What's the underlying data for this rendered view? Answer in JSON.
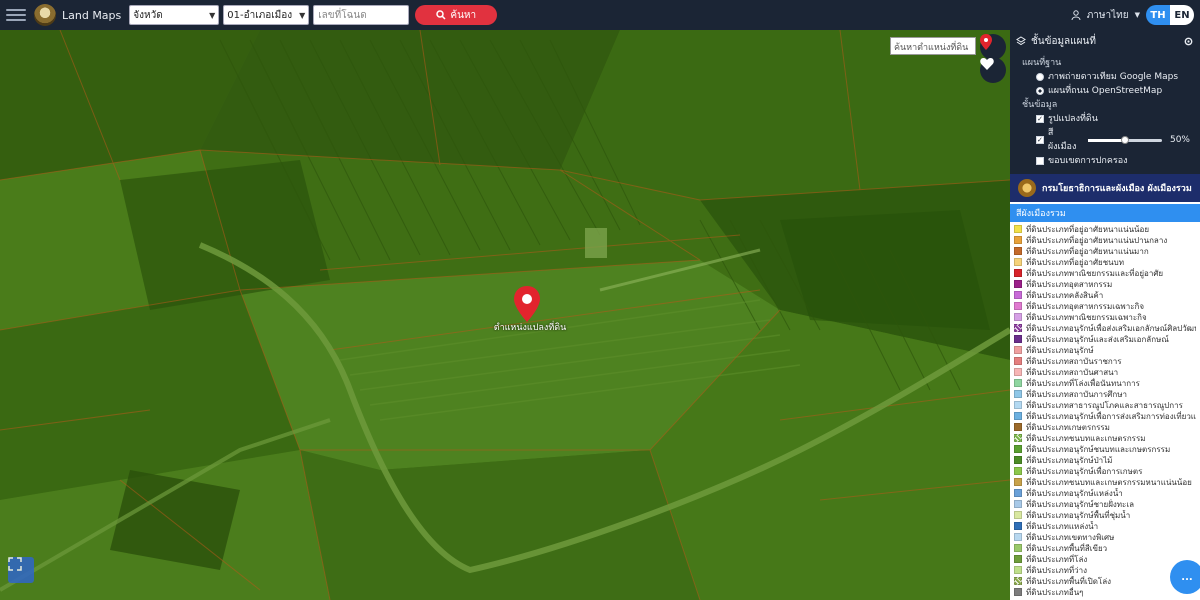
{
  "header": {
    "brand": "Land Maps",
    "province_select": "จังหวัด",
    "district_select": "01-อำเภอเมือง",
    "parcel_input_placeholder": "เลขที่โฉนด",
    "search_label": "ค้นหา",
    "user_label": "ภาษาไทย",
    "lang_on": "TH",
    "lang_off": "EN"
  },
  "map": {
    "search_value": "ค้นหาตำแหน่งที่ดิน",
    "pin_label": "ตำแหน่งแปลงที่ดิน"
  },
  "panel": {
    "title": "ชั้นข้อมูลแผนที่",
    "basemap_heading": "แผนที่ฐาน",
    "basemap_options": [
      {
        "label": "ภาพถ่ายดาวเทียม Google Maps",
        "selected": false
      },
      {
        "label": "แผนที่ถนน OpenStreetMap",
        "selected": true
      }
    ],
    "overlay_heading": "ชั้นข้อมูล",
    "overlays": [
      {
        "label": "รูปแปลงที่ดิน",
        "checked": true
      },
      {
        "label": "สีผังเมือง",
        "checked": true,
        "opacity_percent": 50,
        "opacity_text": "50%"
      },
      {
        "label": "ขอบเขตการปกครอง",
        "checked": false
      }
    ],
    "department": "กรมโยธาธิการและผังเมือง ผังเมืองรวม",
    "legend_title": "สีผังเมืองรวม",
    "legend": [
      {
        "color": "#f2e14a",
        "label": "ที่ดินประเภทที่อยู่อาศัยหนาแน่นน้อย"
      },
      {
        "color": "#e8a23a",
        "label": "ที่ดินประเภทที่อยู่อาศัยหนาแน่นปานกลาง"
      },
      {
        "color": "#c46a2a",
        "label": "ที่ดินประเภทที่อยู่อาศัยหนาแน่นมาก"
      },
      {
        "color": "#f6d37a",
        "label": "ที่ดินประเภทที่อยู่อาศัยชนบท"
      },
      {
        "color": "#d8232a",
        "label": "ที่ดินประเภทพาณิชยกรรมและที่อยู่อาศัย"
      },
      {
        "color": "#9c1f8a",
        "label": "ที่ดินประเภทอุตสาหกรรม"
      },
      {
        "color": "#c86ad8",
        "label": "ที่ดินประเภทคลังสินค้า"
      },
      {
        "color": "#e07ad0",
        "label": "ที่ดินประเภทอุตสาหกรรมเฉพาะกิจ"
      },
      {
        "color": "#d6a0e6",
        "label": "ที่ดินประเภทพาณิชยกรรมเฉพาะกิจ"
      },
      {
        "color": "#8b3c9e",
        "label": "ที่ดินประเภทอนุรักษ์เพื่อส่งเสริมเอกลักษณ์ศิลปวัฒนธรรมไทย",
        "hatch": true
      },
      {
        "color": "#6b2e8c",
        "label": "ที่ดินประเภทอนุรักษ์และส่งเสริมเอกลักษณ์"
      },
      {
        "color": "#f0a0a0",
        "label": "ที่ดินประเภทอนุรักษ์"
      },
      {
        "color": "#e57f7f",
        "label": "ที่ดินประเภทสถาบันราชการ"
      },
      {
        "color": "#f7b5b5",
        "label": "ที่ดินประเภทสถาบันศาสนา"
      },
      {
        "color": "#8fd6a0",
        "label": "ที่ดินประเภทที่โล่งเพื่อนันทนาการ"
      },
      {
        "color": "#8fc7e8",
        "label": "ที่ดินประเภทสถาบันการศึกษา"
      },
      {
        "color": "#b3d9f2",
        "label": "ที่ดินประเภทสาธารณูปโภคและสาธารณูปการ"
      },
      {
        "color": "#6cb0e0",
        "label": "ที่ดินประเภทอนุรักษ์เพื่อการส่งเสริมการท่องเที่ยวและสิ่งแวดล้อม"
      },
      {
        "color": "#9c6a2a",
        "label": "ที่ดินประเภทเกษตรกรรม"
      },
      {
        "color": "#7ab648",
        "label": "ที่ดินประเภทชนบทและเกษตรกรรม",
        "hatch": true
      },
      {
        "color": "#5aa030",
        "label": "ที่ดินประเภทอนุรักษ์ชนบทและเกษตรกรรม"
      },
      {
        "color": "#4c8c26",
        "label": "ที่ดินประเภทอนุรักษ์ป่าไม้"
      },
      {
        "color": "#8cc84b",
        "label": "ที่ดินประเภทอนุรักษ์เพื่อการเกษตร"
      },
      {
        "color": "#c8a24a",
        "label": "ที่ดินประเภทชนบทและเกษตรกรรมหนาแน่นน้อย"
      },
      {
        "color": "#6aa0d8",
        "label": "ที่ดินประเภทอนุรักษ์แหล่งน้ำ"
      },
      {
        "color": "#a8c9e8",
        "label": "ที่ดินประเภทอนุรักษ์ชายฝั่งทะเล"
      },
      {
        "color": "#d9e8a0",
        "label": "ที่ดินประเภทอนุรักษ์พื้นที่ชุ่มน้ำ"
      },
      {
        "color": "#2f6fb8",
        "label": "ที่ดินประเภทแหล่งน้ำ"
      },
      {
        "color": "#b8d8f0",
        "label": "ที่ดินประเภทเขตทางพิเศษ"
      },
      {
        "color": "#9ac96a",
        "label": "ที่ดินประเภทพื้นที่สีเขียว"
      },
      {
        "color": "#6e9e3a",
        "label": "ที่ดินประเภทที่โล่ง"
      },
      {
        "color": "#bfe08a",
        "label": "ที่ดินประเภทที่ว่าง"
      },
      {
        "color": "#8aa84a",
        "label": "ที่ดินประเภทพื้นที่เปิดโล่ง",
        "hatch": true
      },
      {
        "color": "#7d7d7d",
        "label": "ที่ดินประเภทอื่นๆ"
      }
    ],
    "fab_label": "..."
  }
}
